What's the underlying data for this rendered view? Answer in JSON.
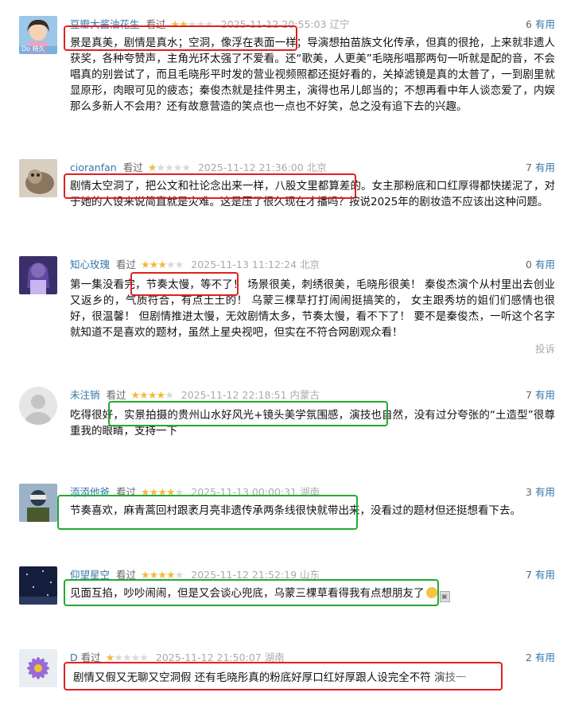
{
  "reviews": [
    {
      "user": "豆瓣大酱油花生",
      "status": "看过",
      "rating": 2,
      "time": "2025-11-12 20:55:03",
      "location": "辽宁",
      "useful_count": "6",
      "useful_label": "有用",
      "text": "景是真美，剧情是真水；空洞，像浮在表面一样；导演想拍苗族文化传承，但真的很抢，上来就非遗人获奖，各种夸赞声，主角光环太强了不爱看。还“歌美，人更美”毛晓彤唱那两句一听就是配的音，不会唱真的别尝试了，而且毛晓彤平时发的营业视频照都还挺好看的，关掉滤镜是真的太普了，一到剧里就显原形，肉眼可见的疲态；秦俊杰就是挂件男主，演得也吊儿郎当的；不想再看中年人谈恋爱了，内娱那么多新人不会用？还有故意营造的笑点也一点也不好笑，总之没有追下去的兴趣。",
      "avatar_label": "Do 柿久"
    },
    {
      "user": "cioranfan",
      "status": "看过",
      "rating": 1,
      "time": "2025-11-12 21:36:00",
      "location": "北京",
      "useful_count": "7",
      "useful_label": "有用",
      "text": "剧情太空洞了，把公文和社论念出来一样，八股文里都算差的。女主那粉底和口红厚得都快搓泥了，对于她的人设来说简直就是灾难。这是压了很久现在才播吗？按说2025年的剧妆造不应该出这种问题。"
    },
    {
      "user": "知心玫瑰",
      "status": "看过",
      "rating": 3,
      "time": "2025-11-13 11:12:24",
      "location": "北京",
      "useful_count": "0",
      "useful_label": "有用",
      "text": "第一集没看完，节奏太慢，等不了！ 场景很美，刺绣很美，毛晓彤很美！ 秦俊杰演个从村里出去创业又返乡的，气质符合，有点土土的！ 乌蒙三棵草打打闹闹挺搞笑的， 女主跟秀坊的姐们们感情也很好，很温馨！ 但剧情推进太慢，无效剧情太多，节奏太慢，看不下了！ 要不是秦俊杰，一听这个名字就知道不是喜欢的题材，虽然上星央视吧，但实在不符合网剧观众看！",
      "report_label": "投诉"
    },
    {
      "user": "未注销",
      "status": "看过",
      "rating": 4,
      "time": "2025-11-12 22:18:51",
      "location": "内蒙古",
      "useful_count": "7",
      "useful_label": "有用",
      "text": "吃得很好，实景拍摄的贵州山水好风光+镜头美学氛围感，演技也自然，没有过分夸张的“土造型”很尊重我的眼睛，支持一下"
    },
    {
      "user": "添添他爸",
      "status": "看过",
      "rating": 4,
      "time": "2025-11-13 00:00:31",
      "location": "湖南",
      "useful_count": "3",
      "useful_label": "有用",
      "text": "节奏喜欢，麻青蒿回村跟袤月亮非遗传承两条线很快就带出来，没看过的题材但还挺想看下去。"
    },
    {
      "user": "仰望星空",
      "status": "看过",
      "rating": 4,
      "time": "2025-11-12 21:52:19",
      "location": "山东",
      "useful_count": "7",
      "useful_label": "有用",
      "text": "见面互掐，吵吵闹闹，但是又会谈心兜底，乌蒙三棵草看得我有点想朋友了"
    },
    {
      "user": "D",
      "status": "看过",
      "rating": 1,
      "time": "2025-11-12 21:50:07",
      "location": "湖南",
      "useful_count": "2",
      "useful_label": "有用",
      "text": "剧情又假又无聊又空洞假 还有毛晓彤真的粉底好厚口红好厚跟人设完全不符 演技一"
    }
  ],
  "colors": {
    "username": "#3377aa",
    "star_on": "#f4b93c",
    "star_off": "#d9d9d9",
    "highlight_red": "#e02020",
    "highlight_green": "#22aa33"
  }
}
